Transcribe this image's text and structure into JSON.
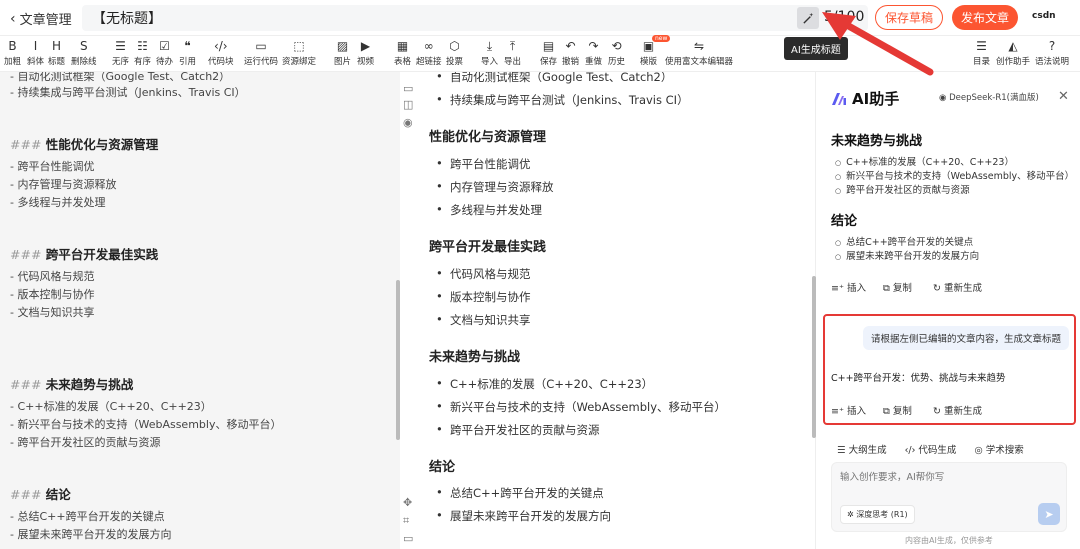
{
  "topbar": {
    "back_label": "文章管理",
    "title_value": "【无标题】",
    "count": "5/100",
    "draft_label": "保存草稿",
    "publish_label": "发布文章",
    "brand": "csdn",
    "tooltip": "AI生成标题"
  },
  "toolbar": {
    "tools": [
      {
        "icon": "B",
        "label": "加粗",
        "name": "bold"
      },
      {
        "icon": "I",
        "label": "斜体",
        "name": "italic"
      },
      {
        "icon": "H",
        "label": "标题",
        "name": "heading"
      },
      {
        "icon": "S",
        "label": "删除线",
        "name": "strike"
      },
      {
        "icon": "☰",
        "label": "无序",
        "name": "unordered-list"
      },
      {
        "icon": "☷",
        "label": "有序",
        "name": "ordered-list"
      },
      {
        "icon": "☑",
        "label": "待办",
        "name": "todo"
      },
      {
        "icon": "❝",
        "label": "引用",
        "name": "quote"
      },
      {
        "icon": "‹/›",
        "label": "代码块",
        "name": "code-block"
      },
      {
        "icon": "▭",
        "label": "运行代码",
        "name": "run-code"
      },
      {
        "icon": "⬚",
        "label": "资源绑定",
        "name": "resource-bind"
      },
      {
        "icon": "▨",
        "label": "图片",
        "name": "image"
      },
      {
        "icon": "▶",
        "label": "视频",
        "name": "video"
      },
      {
        "icon": "▦",
        "label": "表格",
        "name": "table"
      },
      {
        "icon": "∞",
        "label": "超链接",
        "name": "link"
      },
      {
        "icon": "⬡",
        "label": "投票",
        "name": "vote"
      },
      {
        "icon": "⤓",
        "label": "导入",
        "name": "import"
      },
      {
        "icon": "⤒",
        "label": "导出",
        "name": "export"
      },
      {
        "icon": "▤",
        "label": "保存",
        "name": "save"
      },
      {
        "icon": "↶",
        "label": "撤销",
        "name": "undo"
      },
      {
        "icon": "↷",
        "label": "重做",
        "name": "redo"
      },
      {
        "icon": "⟲",
        "label": "历史",
        "name": "history"
      },
      {
        "icon": "▣",
        "label": "模版",
        "name": "template"
      },
      {
        "icon": "⇋",
        "label": "使用富文本编辑器",
        "name": "rich-editor"
      },
      {
        "icon": "☰",
        "label": "目录",
        "name": "toc"
      },
      {
        "icon": "◭",
        "label": "创作助手",
        "name": "assistant"
      },
      {
        "icon": "?",
        "label": "语法说明",
        "name": "syntax-help"
      }
    ],
    "new_badge": "new"
  },
  "editor": {
    "lines": [
      {
        "type": "item",
        "text": "- 自动化测试框架（Google Test、Catch2）"
      },
      {
        "type": "item",
        "text": "- 持续集成与跨平台测试（Jenkins、Travis CI）"
      },
      {
        "type": "h",
        "hash": "###",
        "text": "性能优化与资源管理"
      },
      {
        "type": "item",
        "text": "- 跨平台性能调优"
      },
      {
        "type": "item",
        "text": "- 内存管理与资源释放"
      },
      {
        "type": "item",
        "text": "- 多线程与并发处理"
      },
      {
        "type": "h",
        "hash": "###",
        "text": "跨平台开发最佳实践"
      },
      {
        "type": "item",
        "text": "- 代码风格与规范"
      },
      {
        "type": "item",
        "text": "- 版本控制与协作"
      },
      {
        "type": "item",
        "text": "- 文档与知识共享"
      },
      {
        "type": "h",
        "hash": "###",
        "text": "未来趋势与挑战"
      },
      {
        "type": "item",
        "text": "- C++标准的发展（C++20、C++23）"
      },
      {
        "type": "item",
        "text": "- 新兴平台与技术的支持（WebAssembly、移动平台）"
      },
      {
        "type": "item",
        "text": "- 跨平台开发社区的贡献与资源"
      },
      {
        "type": "h",
        "hash": "###",
        "text": "结论"
      },
      {
        "type": "item",
        "text": "- 总结C++跨平台开发的关键点"
      },
      {
        "type": "item",
        "text": "- 展望未来跨平台开发的发展方向"
      }
    ]
  },
  "preview": {
    "items": [
      {
        "type": "li",
        "text": "自动化测试框架（Google Test、Catch2）"
      },
      {
        "type": "li",
        "text": "持续集成与跨平台测试（Jenkins、Travis CI）"
      },
      {
        "type": "h",
        "text": "性能优化与资源管理"
      },
      {
        "type": "li",
        "text": "跨平台性能调优"
      },
      {
        "type": "li",
        "text": "内存管理与资源释放"
      },
      {
        "type": "li",
        "text": "多线程与并发处理"
      },
      {
        "type": "h",
        "text": "跨平台开发最佳实践"
      },
      {
        "type": "li",
        "text": "代码风格与规范"
      },
      {
        "type": "li",
        "text": "版本控制与协作"
      },
      {
        "type": "li",
        "text": "文档与知识共享"
      },
      {
        "type": "h",
        "text": "未来趋势与挑战"
      },
      {
        "type": "li",
        "text": "C++标准的发展（C++20、C++23）"
      },
      {
        "type": "li",
        "text": "新兴平台与技术的支持（WebAssembly、移动平台）"
      },
      {
        "type": "li",
        "text": "跨平台开发社区的贡献与资源"
      },
      {
        "type": "h",
        "text": "结论"
      },
      {
        "type": "li",
        "text": "总结C++跨平台开发的关键点"
      },
      {
        "type": "li",
        "text": "展望未来跨平台开发的发展方向"
      }
    ]
  },
  "ai": {
    "title": "AI助手",
    "model": "DeepSeek-R1(满血版)",
    "section1_title": "未来趋势与挑战",
    "section1_items": [
      "C++标准的发展（C++20、C++23）",
      "新兴平台与技术的支持（WebAssembly、移动平台）",
      "跨平台开发社区的贡献与资源"
    ],
    "section2_title": "结论",
    "section2_items": [
      "总结C++跨平台开发的关键点",
      "展望未来跨平台开发的发展方向"
    ],
    "insert_label": "插入",
    "copy_label": "复制",
    "regen_label": "重新生成",
    "user_message": "请根据左侧已编辑的文章内容，生成文章标题",
    "answer": "C++跨平台开发：优势、挑战与未来趋势",
    "tabs": [
      "大纲生成",
      "代码生成",
      "学术搜索"
    ],
    "input_placeholder": "输入创作要求，AI帮你写",
    "deep_label": "深度思考 (R1)",
    "footer": "内容由AI生成，仅供参考"
  },
  "colors": {
    "accent": "#fc5531",
    "highlight": "#e53935"
  }
}
